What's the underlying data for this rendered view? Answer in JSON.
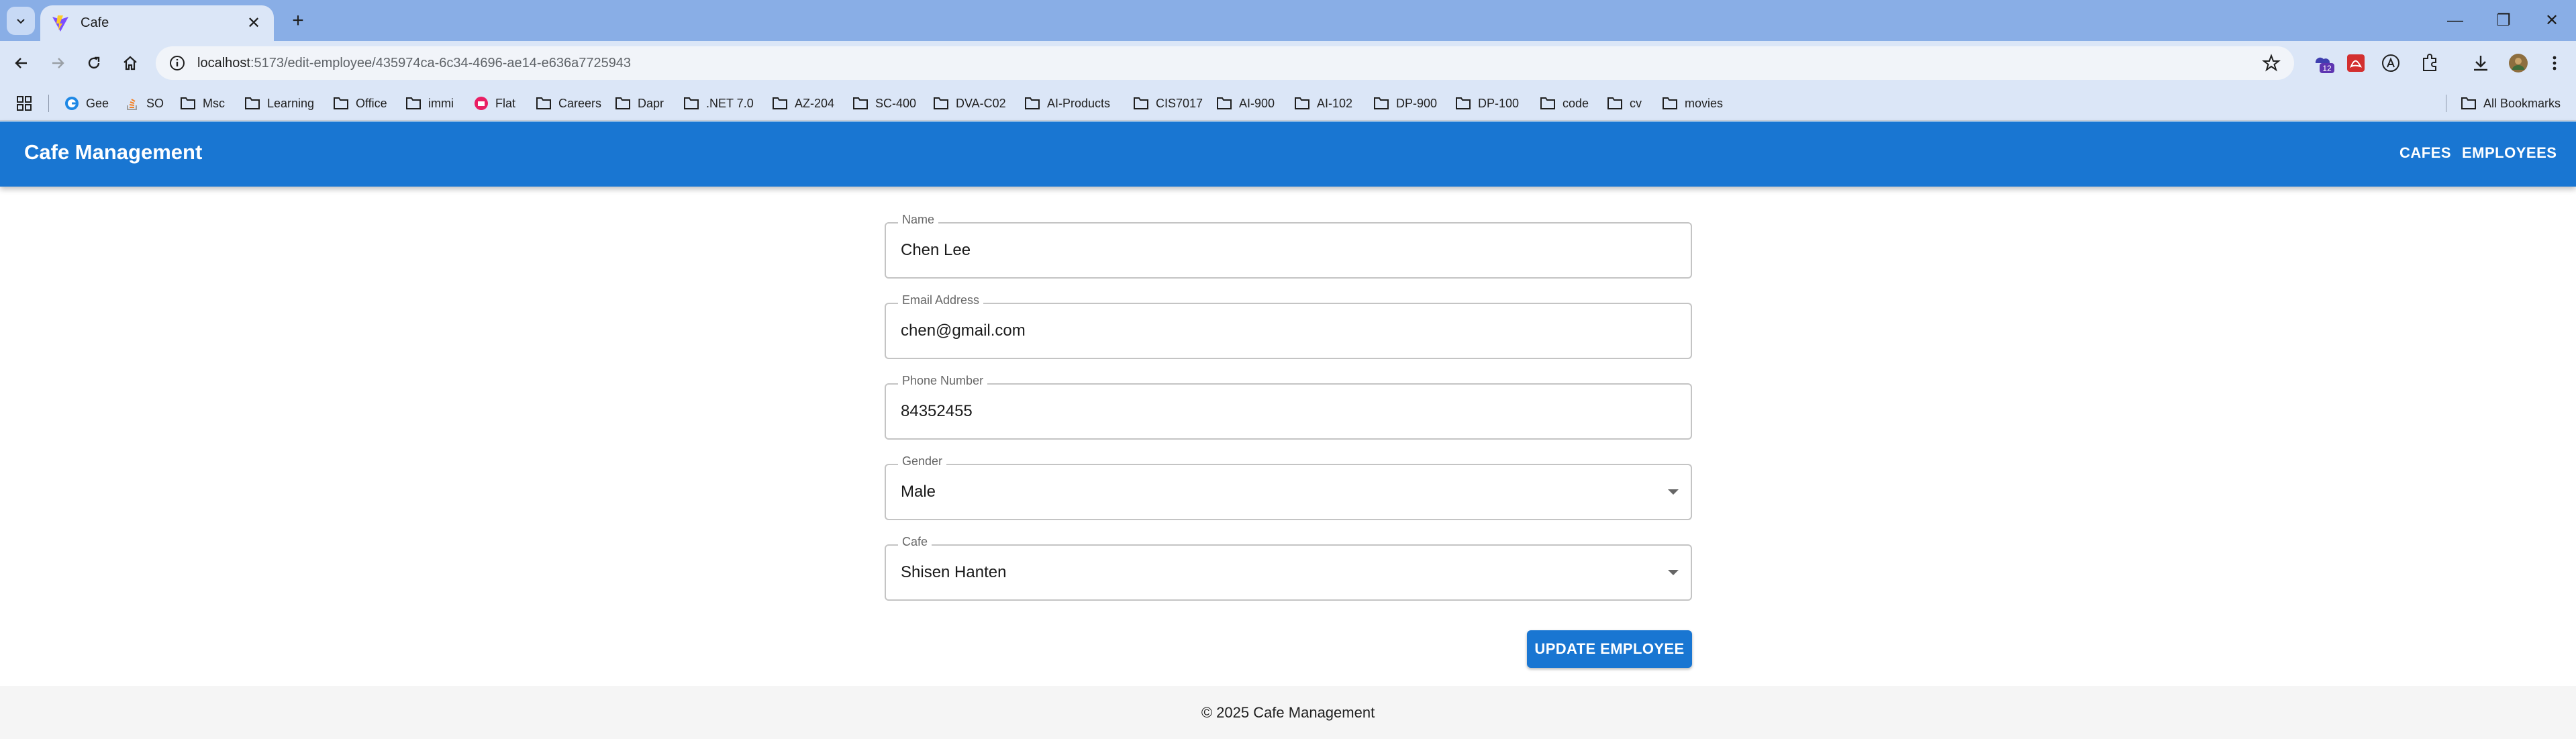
{
  "browser": {
    "tab": {
      "title": "Cafe",
      "close_glyph": "✕"
    },
    "new_tab_glyph": "+",
    "url": {
      "host": "localhost",
      "path": ":5173/edit-employee/435974ca-6c34-4696-ae14-e636a7725943"
    },
    "window_controls": {
      "minimize": "—",
      "restore": "❐",
      "close": "✕"
    },
    "extension_badge": "12",
    "bookmarks": [
      {
        "label": "Gee",
        "icon": "gee-favicon-icon"
      },
      {
        "label": "SO",
        "icon": "stackoverflow-icon"
      },
      {
        "label": "Msc",
        "icon": "folder-icon"
      },
      {
        "label": "Learning",
        "icon": "folder-icon"
      },
      {
        "label": "Office",
        "icon": "folder-icon"
      },
      {
        "label": "immi",
        "icon": "folder-icon"
      },
      {
        "label": "Flat",
        "icon": "flat-favicon-icon"
      },
      {
        "label": "Careers",
        "icon": "folder-icon"
      },
      {
        "label": "Dapr",
        "icon": "folder-icon"
      },
      {
        "label": ".NET 7.0",
        "icon": "folder-icon"
      },
      {
        "label": "AZ-204",
        "icon": "folder-icon"
      },
      {
        "label": "SC-400",
        "icon": "folder-icon"
      },
      {
        "label": "DVA-C02",
        "icon": "folder-icon"
      },
      {
        "label": "AI-Products",
        "icon": "folder-icon"
      },
      {
        "label": "CIS7017",
        "icon": "folder-icon"
      },
      {
        "label": "AI-900",
        "icon": "folder-icon"
      },
      {
        "label": "AI-102",
        "icon": "folder-icon"
      },
      {
        "label": "DP-900",
        "icon": "folder-icon"
      },
      {
        "label": "DP-100",
        "icon": "folder-icon"
      },
      {
        "label": "code",
        "icon": "folder-icon"
      },
      {
        "label": "cv",
        "icon": "folder-icon"
      },
      {
        "label": "movies",
        "icon": "folder-icon"
      }
    ],
    "all_bookmarks": "All Bookmarks"
  },
  "app": {
    "title": "Cafe Management",
    "nav": {
      "cafes": "CAFES",
      "employees": "EMPLOYEES"
    },
    "form": {
      "name": {
        "label": "Name",
        "value": "Chen Lee"
      },
      "email": {
        "label": "Email Address",
        "value": "chen@gmail.com"
      },
      "phone": {
        "label": "Phone Number",
        "value": "84352455"
      },
      "gender": {
        "label": "Gender",
        "value": "Male"
      },
      "cafe": {
        "label": "Cafe",
        "value": "Shisen Hanten"
      },
      "submit": "UPDATE EMPLOYEE"
    },
    "footer": "© 2025 Cafe Management"
  },
  "colors": {
    "primary": "#1976d2",
    "tabstrip": "#89aee6",
    "toolbar": "#dbe6f7",
    "footer_bg": "#f5f5f5"
  }
}
